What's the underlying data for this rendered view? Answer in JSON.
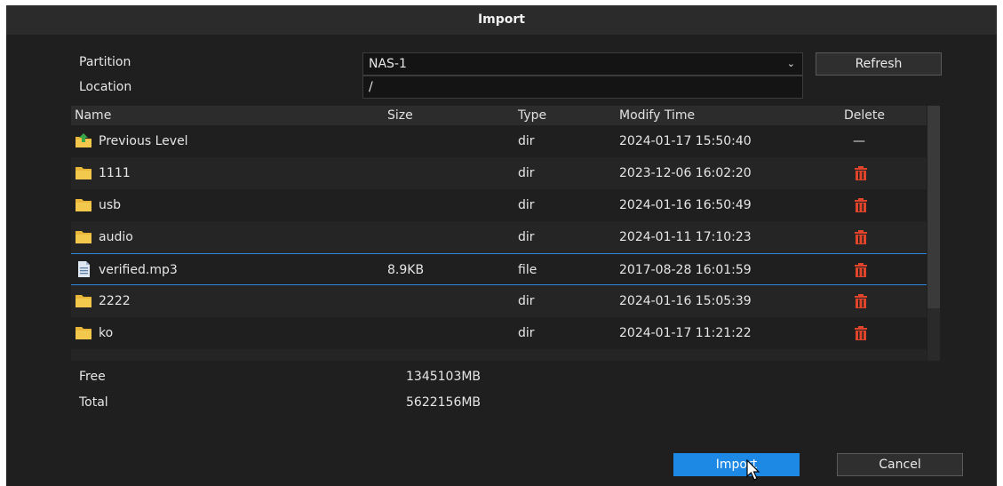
{
  "dialog": {
    "title": "Import"
  },
  "form": {
    "partition_label": "Partition",
    "partition_value": "NAS-1",
    "location_label": "Location",
    "location_value": "/",
    "refresh_label": "Refresh"
  },
  "table": {
    "headers": {
      "name": "Name",
      "size": "Size",
      "type": "Type",
      "modify": "Modify Time",
      "delete": "Delete"
    },
    "rows": [
      {
        "name": "Previous Level",
        "size": "",
        "type": "dir",
        "modify": "2024-01-17 15:50:40",
        "delete": "—",
        "icon": "folder-up-icon"
      },
      {
        "name": "1111",
        "size": "",
        "type": "dir",
        "modify": "2023-12-06 16:02:20",
        "icon": "folder-icon"
      },
      {
        "name": "usb",
        "size": "",
        "type": "dir",
        "modify": "2024-01-16 16:50:49",
        "icon": "folder-icon"
      },
      {
        "name": "audio",
        "size": "",
        "type": "dir",
        "modify": "2024-01-11 17:10:23",
        "icon": "folder-icon"
      },
      {
        "name": "verified.mp3",
        "size": "8.9KB",
        "type": "file",
        "modify": "2017-08-28 16:01:59",
        "icon": "file-icon"
      },
      {
        "name": "2222",
        "size": "",
        "type": "dir",
        "modify": "2024-01-16 15:05:39",
        "icon": "folder-icon"
      },
      {
        "name": "ko",
        "size": "",
        "type": "dir",
        "modify": "2024-01-17 11:21:22",
        "icon": "folder-icon"
      }
    ]
  },
  "storage": {
    "free_label": "Free",
    "free_value": "1345103MB",
    "total_label": "Total",
    "total_value": "5622156MB"
  },
  "buttons": {
    "import_label": "Import",
    "cancel_label": "Cancel"
  },
  "colors": {
    "accent": "#1e88e5",
    "delete": "#e0442b",
    "folder": "#f2c94c"
  }
}
